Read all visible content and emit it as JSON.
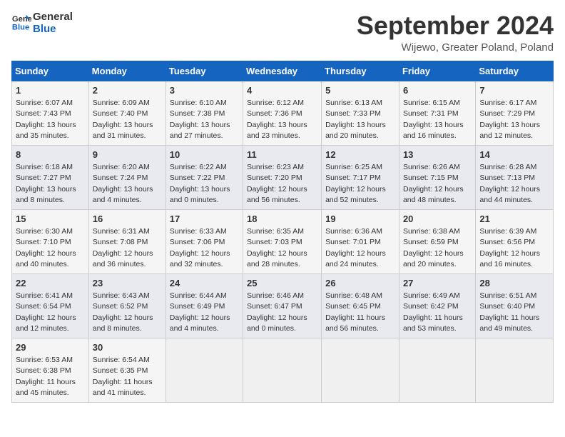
{
  "header": {
    "logo_line1": "General",
    "logo_line2": "Blue",
    "month": "September 2024",
    "location": "Wijewo, Greater Poland, Poland"
  },
  "weekdays": [
    "Sunday",
    "Monday",
    "Tuesday",
    "Wednesday",
    "Thursday",
    "Friday",
    "Saturday"
  ],
  "weeks": [
    [
      {
        "day": "1",
        "sunrise": "6:07 AM",
        "sunset": "7:43 PM",
        "daylight": "13 hours and 35 minutes."
      },
      {
        "day": "2",
        "sunrise": "6:09 AM",
        "sunset": "7:40 PM",
        "daylight": "13 hours and 31 minutes."
      },
      {
        "day": "3",
        "sunrise": "6:10 AM",
        "sunset": "7:38 PM",
        "daylight": "13 hours and 27 minutes."
      },
      {
        "day": "4",
        "sunrise": "6:12 AM",
        "sunset": "7:36 PM",
        "daylight": "13 hours and 23 minutes."
      },
      {
        "day": "5",
        "sunrise": "6:13 AM",
        "sunset": "7:33 PM",
        "daylight": "13 hours and 20 minutes."
      },
      {
        "day": "6",
        "sunrise": "6:15 AM",
        "sunset": "7:31 PM",
        "daylight": "13 hours and 16 minutes."
      },
      {
        "day": "7",
        "sunrise": "6:17 AM",
        "sunset": "7:29 PM",
        "daylight": "13 hours and 12 minutes."
      }
    ],
    [
      {
        "day": "8",
        "sunrise": "6:18 AM",
        "sunset": "7:27 PM",
        "daylight": "13 hours and 8 minutes."
      },
      {
        "day": "9",
        "sunrise": "6:20 AM",
        "sunset": "7:24 PM",
        "daylight": "13 hours and 4 minutes."
      },
      {
        "day": "10",
        "sunrise": "6:22 AM",
        "sunset": "7:22 PM",
        "daylight": "13 hours and 0 minutes."
      },
      {
        "day": "11",
        "sunrise": "6:23 AM",
        "sunset": "7:20 PM",
        "daylight": "12 hours and 56 minutes."
      },
      {
        "day": "12",
        "sunrise": "6:25 AM",
        "sunset": "7:17 PM",
        "daylight": "12 hours and 52 minutes."
      },
      {
        "day": "13",
        "sunrise": "6:26 AM",
        "sunset": "7:15 PM",
        "daylight": "12 hours and 48 minutes."
      },
      {
        "day": "14",
        "sunrise": "6:28 AM",
        "sunset": "7:13 PM",
        "daylight": "12 hours and 44 minutes."
      }
    ],
    [
      {
        "day": "15",
        "sunrise": "6:30 AM",
        "sunset": "7:10 PM",
        "daylight": "12 hours and 40 minutes."
      },
      {
        "day": "16",
        "sunrise": "6:31 AM",
        "sunset": "7:08 PM",
        "daylight": "12 hours and 36 minutes."
      },
      {
        "day": "17",
        "sunrise": "6:33 AM",
        "sunset": "7:06 PM",
        "daylight": "12 hours and 32 minutes."
      },
      {
        "day": "18",
        "sunrise": "6:35 AM",
        "sunset": "7:03 PM",
        "daylight": "12 hours and 28 minutes."
      },
      {
        "day": "19",
        "sunrise": "6:36 AM",
        "sunset": "7:01 PM",
        "daylight": "12 hours and 24 minutes."
      },
      {
        "day": "20",
        "sunrise": "6:38 AM",
        "sunset": "6:59 PM",
        "daylight": "12 hours and 20 minutes."
      },
      {
        "day": "21",
        "sunrise": "6:39 AM",
        "sunset": "6:56 PM",
        "daylight": "12 hours and 16 minutes."
      }
    ],
    [
      {
        "day": "22",
        "sunrise": "6:41 AM",
        "sunset": "6:54 PM",
        "daylight": "12 hours and 12 minutes."
      },
      {
        "day": "23",
        "sunrise": "6:43 AM",
        "sunset": "6:52 PM",
        "daylight": "12 hours and 8 minutes."
      },
      {
        "day": "24",
        "sunrise": "6:44 AM",
        "sunset": "6:49 PM",
        "daylight": "12 hours and 4 minutes."
      },
      {
        "day": "25",
        "sunrise": "6:46 AM",
        "sunset": "6:47 PM",
        "daylight": "12 hours and 0 minutes."
      },
      {
        "day": "26",
        "sunrise": "6:48 AM",
        "sunset": "6:45 PM",
        "daylight": "11 hours and 56 minutes."
      },
      {
        "day": "27",
        "sunrise": "6:49 AM",
        "sunset": "6:42 PM",
        "daylight": "11 hours and 53 minutes."
      },
      {
        "day": "28",
        "sunrise": "6:51 AM",
        "sunset": "6:40 PM",
        "daylight": "11 hours and 49 minutes."
      }
    ],
    [
      {
        "day": "29",
        "sunrise": "6:53 AM",
        "sunset": "6:38 PM",
        "daylight": "11 hours and 45 minutes."
      },
      {
        "day": "30",
        "sunrise": "6:54 AM",
        "sunset": "6:35 PM",
        "daylight": "11 hours and 41 minutes."
      },
      null,
      null,
      null,
      null,
      null
    ]
  ]
}
